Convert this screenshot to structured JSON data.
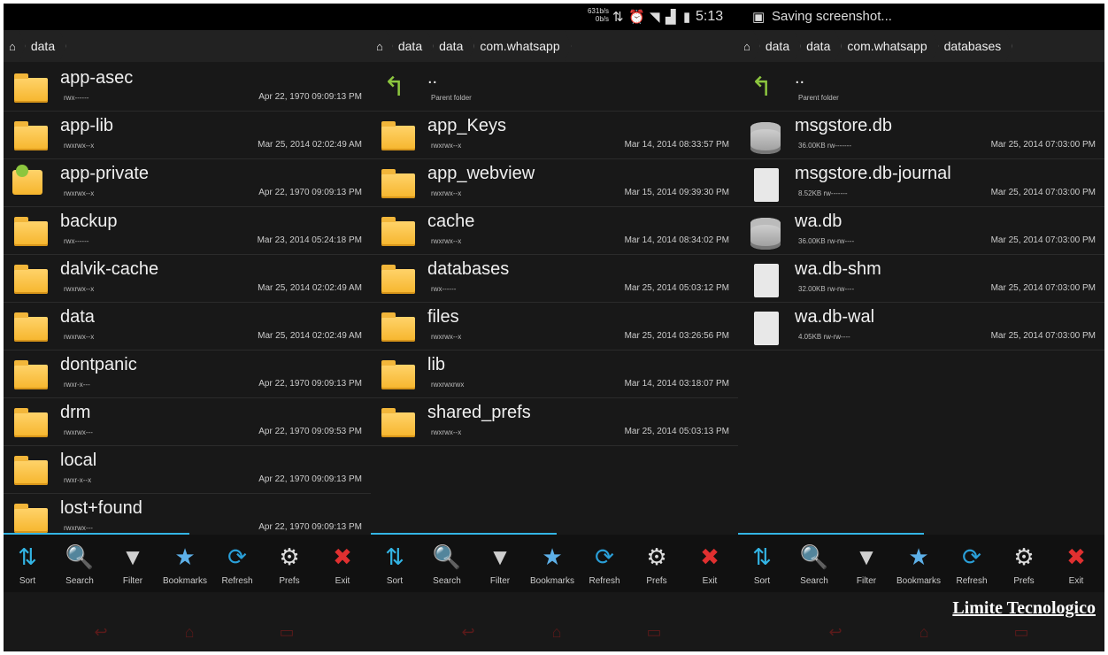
{
  "status": {
    "net_up": "631b/s",
    "net_down": "0b/s",
    "time": "5:13",
    "notification": "Saving screenshot...",
    "icons": [
      "data-transfer-icon",
      "alarm-icon",
      "wifi-icon",
      "signal-icon",
      "battery-icon",
      "screenshot-icon"
    ]
  },
  "panes": [
    {
      "breadcrumb": [
        "data"
      ],
      "items": [
        {
          "name": "app-asec",
          "perm": "rwx------",
          "date": "Apr 22, 1970 09:09:13 PM",
          "icon": "folder-icon"
        },
        {
          "name": "app-lib",
          "perm": "rwxrwx--x",
          "date": "Mar 25, 2014 02:02:49 AM",
          "icon": "folder-icon"
        },
        {
          "name": "app-private",
          "perm": "rwxrwx--x",
          "date": "Apr 22, 1970 09:09:13 PM",
          "icon": "apk-folder-icon"
        },
        {
          "name": "backup",
          "perm": "rwx------",
          "date": "Mar 23, 2014 05:24:18 PM",
          "icon": "folder-icon"
        },
        {
          "name": "dalvik-cache",
          "perm": "rwxrwx--x",
          "date": "Mar 25, 2014 02:02:49 AM",
          "icon": "folder-icon"
        },
        {
          "name": "data",
          "perm": "rwxrwx--x",
          "date": "Mar 25, 2014 02:02:49 AM",
          "icon": "folder-icon"
        },
        {
          "name": "dontpanic",
          "perm": "rwxr-x---",
          "date": "Apr 22, 1970 09:09:13 PM",
          "icon": "folder-icon"
        },
        {
          "name": "drm",
          "perm": "rwxrwx---",
          "date": "Apr 22, 1970 09:09:53 PM",
          "icon": "folder-icon"
        },
        {
          "name": "local",
          "perm": "rwxr-x--x",
          "date": "Apr 22, 1970 09:09:13 PM",
          "icon": "folder-icon"
        },
        {
          "name": "lost+found",
          "perm": "rwxrwx---",
          "date": "Apr 22, 1970 09:09:13 PM",
          "icon": "folder-icon"
        }
      ]
    },
    {
      "breadcrumb": [
        "data",
        "data",
        "com.whatsapp"
      ],
      "items": [
        {
          "name": "..",
          "perm": "Parent folder",
          "date": "",
          "icon": "up-arrow-icon"
        },
        {
          "name": "app_Keys",
          "perm": "rwxrwx--x",
          "date": "Mar 14, 2014 08:33:57 PM",
          "icon": "folder-icon"
        },
        {
          "name": "app_webview",
          "perm": "rwxrwx--x",
          "date": "Mar 15, 2014 09:39:30 PM",
          "icon": "folder-icon"
        },
        {
          "name": "cache",
          "perm": "rwxrwx--x",
          "date": "Mar 14, 2014 08:34:02 PM",
          "icon": "folder-icon"
        },
        {
          "name": "databases",
          "perm": "rwx------",
          "date": "Mar 25, 2014 05:03:12 PM",
          "icon": "folder-icon"
        },
        {
          "name": "files",
          "perm": "rwxrwx--x",
          "date": "Mar 25, 2014 03:26:56 PM",
          "icon": "folder-icon"
        },
        {
          "name": "lib",
          "perm": "rwxrwxrwx",
          "date": "Mar 14, 2014 03:18:07 PM",
          "icon": "folder-icon"
        },
        {
          "name": "shared_prefs",
          "perm": "rwxrwx--x",
          "date": "Mar 25, 2014 05:03:13 PM",
          "icon": "folder-icon"
        }
      ]
    },
    {
      "breadcrumb": [
        "data",
        "data",
        "com.whatsapp",
        "databases"
      ],
      "items": [
        {
          "name": "..",
          "perm": "Parent folder",
          "date": "",
          "icon": "up-arrow-icon"
        },
        {
          "name": "msgstore.db",
          "perm": "36.00KB rw-------",
          "date": "Mar 25, 2014 07:03:00 PM",
          "icon": "database-icon"
        },
        {
          "name": "msgstore.db-journal",
          "perm": "8.52KB rw-------",
          "date": "Mar 25, 2014 07:03:00 PM",
          "icon": "file-icon"
        },
        {
          "name": "wa.db",
          "perm": "36.00KB rw-rw----",
          "date": "Mar 25, 2014 07:03:00 PM",
          "icon": "database-icon"
        },
        {
          "name": "wa.db-shm",
          "perm": "32.00KB rw-rw----",
          "date": "Mar 25, 2014 07:03:00 PM",
          "icon": "file-icon"
        },
        {
          "name": "wa.db-wal",
          "perm": "4.05KB rw-rw----",
          "date": "Mar 25, 2014 07:03:00 PM",
          "icon": "file-icon"
        }
      ]
    }
  ],
  "toolbar": [
    {
      "label": "Sort",
      "icon": "sort-icon",
      "color": "#33b5e5"
    },
    {
      "label": "Search",
      "icon": "search-icon",
      "color": "#cfd8e0"
    },
    {
      "label": "Filter",
      "icon": "filter-icon",
      "color": "#cfcfcf"
    },
    {
      "label": "Bookmarks",
      "icon": "star-icon",
      "color": "#5db0e8"
    },
    {
      "label": "Refresh",
      "icon": "refresh-icon",
      "color": "#2a9fd8"
    },
    {
      "label": "Prefs",
      "icon": "gear-icon",
      "color": "#dddddd"
    },
    {
      "label": "Exit",
      "icon": "close-icon",
      "color": "#e03030"
    }
  ],
  "watermark": "Limite Tecnologico",
  "colors": {
    "accent": "#33b5e5",
    "folder": "#f6b52c",
    "background": "#181818"
  }
}
